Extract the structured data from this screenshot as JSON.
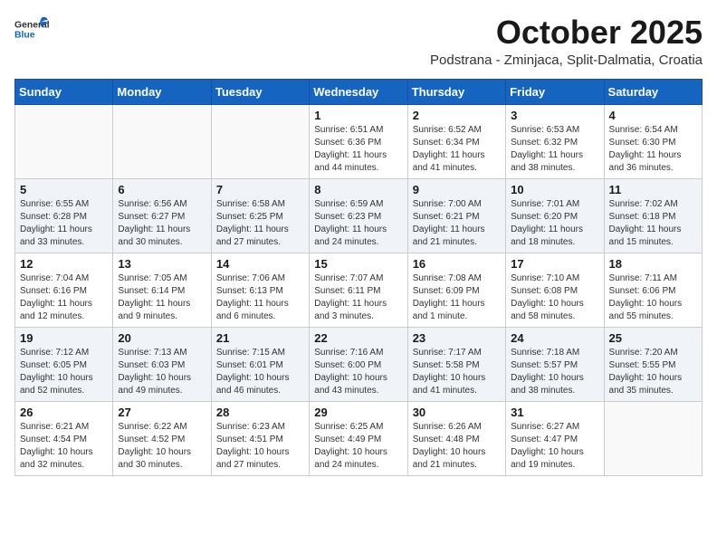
{
  "header": {
    "logo_general": "General",
    "logo_blue": "Blue",
    "month_title": "October 2025",
    "location": "Podstrana - Zminjaca, Split-Dalmatia, Croatia"
  },
  "weekdays": [
    "Sunday",
    "Monday",
    "Tuesday",
    "Wednesday",
    "Thursday",
    "Friday",
    "Saturday"
  ],
  "weeks": [
    [
      {
        "day": "",
        "info": ""
      },
      {
        "day": "",
        "info": ""
      },
      {
        "day": "",
        "info": ""
      },
      {
        "day": "1",
        "info": "Sunrise: 6:51 AM\nSunset: 6:36 PM\nDaylight: 11 hours\nand 44 minutes."
      },
      {
        "day": "2",
        "info": "Sunrise: 6:52 AM\nSunset: 6:34 PM\nDaylight: 11 hours\nand 41 minutes."
      },
      {
        "day": "3",
        "info": "Sunrise: 6:53 AM\nSunset: 6:32 PM\nDaylight: 11 hours\nand 38 minutes."
      },
      {
        "day": "4",
        "info": "Sunrise: 6:54 AM\nSunset: 6:30 PM\nDaylight: 11 hours\nand 36 minutes."
      }
    ],
    [
      {
        "day": "5",
        "info": "Sunrise: 6:55 AM\nSunset: 6:28 PM\nDaylight: 11 hours\nand 33 minutes."
      },
      {
        "day": "6",
        "info": "Sunrise: 6:56 AM\nSunset: 6:27 PM\nDaylight: 11 hours\nand 30 minutes."
      },
      {
        "day": "7",
        "info": "Sunrise: 6:58 AM\nSunset: 6:25 PM\nDaylight: 11 hours\nand 27 minutes."
      },
      {
        "day": "8",
        "info": "Sunrise: 6:59 AM\nSunset: 6:23 PM\nDaylight: 11 hours\nand 24 minutes."
      },
      {
        "day": "9",
        "info": "Sunrise: 7:00 AM\nSunset: 6:21 PM\nDaylight: 11 hours\nand 21 minutes."
      },
      {
        "day": "10",
        "info": "Sunrise: 7:01 AM\nSunset: 6:20 PM\nDaylight: 11 hours\nand 18 minutes."
      },
      {
        "day": "11",
        "info": "Sunrise: 7:02 AM\nSunset: 6:18 PM\nDaylight: 11 hours\nand 15 minutes."
      }
    ],
    [
      {
        "day": "12",
        "info": "Sunrise: 7:04 AM\nSunset: 6:16 PM\nDaylight: 11 hours\nand 12 minutes."
      },
      {
        "day": "13",
        "info": "Sunrise: 7:05 AM\nSunset: 6:14 PM\nDaylight: 11 hours\nand 9 minutes."
      },
      {
        "day": "14",
        "info": "Sunrise: 7:06 AM\nSunset: 6:13 PM\nDaylight: 11 hours\nand 6 minutes."
      },
      {
        "day": "15",
        "info": "Sunrise: 7:07 AM\nSunset: 6:11 PM\nDaylight: 11 hours\nand 3 minutes."
      },
      {
        "day": "16",
        "info": "Sunrise: 7:08 AM\nSunset: 6:09 PM\nDaylight: 11 hours\nand 1 minute."
      },
      {
        "day": "17",
        "info": "Sunrise: 7:10 AM\nSunset: 6:08 PM\nDaylight: 10 hours\nand 58 minutes."
      },
      {
        "day": "18",
        "info": "Sunrise: 7:11 AM\nSunset: 6:06 PM\nDaylight: 10 hours\nand 55 minutes."
      }
    ],
    [
      {
        "day": "19",
        "info": "Sunrise: 7:12 AM\nSunset: 6:05 PM\nDaylight: 10 hours\nand 52 minutes."
      },
      {
        "day": "20",
        "info": "Sunrise: 7:13 AM\nSunset: 6:03 PM\nDaylight: 10 hours\nand 49 minutes."
      },
      {
        "day": "21",
        "info": "Sunrise: 7:15 AM\nSunset: 6:01 PM\nDaylight: 10 hours\nand 46 minutes."
      },
      {
        "day": "22",
        "info": "Sunrise: 7:16 AM\nSunset: 6:00 PM\nDaylight: 10 hours\nand 43 minutes."
      },
      {
        "day": "23",
        "info": "Sunrise: 7:17 AM\nSunset: 5:58 PM\nDaylight: 10 hours\nand 41 minutes."
      },
      {
        "day": "24",
        "info": "Sunrise: 7:18 AM\nSunset: 5:57 PM\nDaylight: 10 hours\nand 38 minutes."
      },
      {
        "day": "25",
        "info": "Sunrise: 7:20 AM\nSunset: 5:55 PM\nDaylight: 10 hours\nand 35 minutes."
      }
    ],
    [
      {
        "day": "26",
        "info": "Sunrise: 6:21 AM\nSunset: 4:54 PM\nDaylight: 10 hours\nand 32 minutes."
      },
      {
        "day": "27",
        "info": "Sunrise: 6:22 AM\nSunset: 4:52 PM\nDaylight: 10 hours\nand 30 minutes."
      },
      {
        "day": "28",
        "info": "Sunrise: 6:23 AM\nSunset: 4:51 PM\nDaylight: 10 hours\nand 27 minutes."
      },
      {
        "day": "29",
        "info": "Sunrise: 6:25 AM\nSunset: 4:49 PM\nDaylight: 10 hours\nand 24 minutes."
      },
      {
        "day": "30",
        "info": "Sunrise: 6:26 AM\nSunset: 4:48 PM\nDaylight: 10 hours\nand 21 minutes."
      },
      {
        "day": "31",
        "info": "Sunrise: 6:27 AM\nSunset: 4:47 PM\nDaylight: 10 hours\nand 19 minutes."
      },
      {
        "day": "",
        "info": ""
      }
    ]
  ]
}
